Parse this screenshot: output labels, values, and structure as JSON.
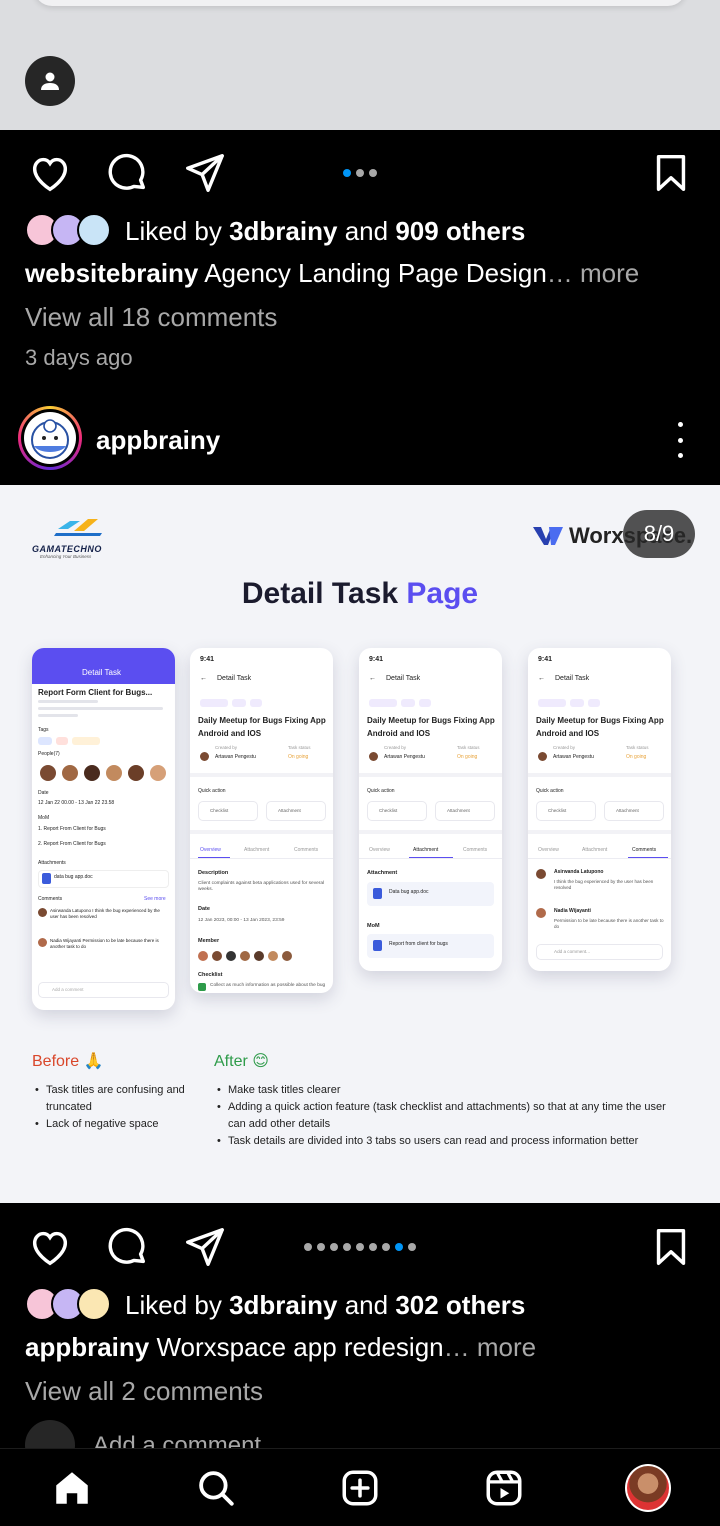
{
  "previous_post": {
    "likes": {
      "prefix": "Liked by",
      "user": "3dbrainy",
      "conj": "and",
      "others": "909 others"
    },
    "caption": {
      "user": "websitebrainy",
      "text": "Agency Landing Page Design",
      "more": "… more"
    },
    "view_comments": "View all 18 comments",
    "time_ago": "3 days ago"
  },
  "post": {
    "username": "appbrainy",
    "image_counter": "8/9",
    "image": {
      "logo_left": {
        "name": "GAMATECHNO",
        "tagline": "Enhancing Your Business"
      },
      "logo_right": "Worxspace.",
      "title_a": "Detail Task",
      "title_b": "Page",
      "before_label": "Before 🙏",
      "after_label": "After 😊",
      "before_points": [
        "Task titles are confusing and truncated",
        "Lack of negative space"
      ],
      "after_points": [
        "Make task titles clearer",
        "Adding a quick action feature (task checklist and attachments) so that at any time the user can add other details",
        "Task details are divided into 3 tabs so users can read and process information better"
      ],
      "phones": {
        "before": {
          "header": "Detail Task",
          "task_title": "Report Form Client for Bugs...",
          "tags_label": "Tags",
          "people_label": "People(7)",
          "date_label": "Date",
          "date_value": "12 Jan 22 00.00 - 13 Jan 22 23.58",
          "mom_label": "MoM",
          "mom_1": "1. Report From Client for Bugs",
          "mom_2": "2. Report From Client for Bugs",
          "attachments_label": "Attachments",
          "attachment_file": "data bug app.doc",
          "comments_label": "Comments",
          "see_more": "See more",
          "comment_1": "Asirwanda Latupono I think the bug experienced by the user has been resolved",
          "comment_2": "Nadia Wijayanti Permission to be late because there is another task to do",
          "add_comment": "Add a comment"
        },
        "after_common": {
          "time": "9:41",
          "header": "Detail Task",
          "tags": [
            "Necessary",
            "Bugs",
            "API"
          ],
          "task_title_1": "Daily Meetup for Bugs Fixing App",
          "task_title_2": "Android and IOS",
          "created_by_label": "Created by",
          "created_by": "Artawan Pengestu",
          "status_label": "Task status",
          "status": "On going",
          "quick_action": "Quick action",
          "checklist": "Checklist",
          "attachment": "Attachment",
          "tabs": [
            "Overview",
            "Attachment",
            "Comments"
          ]
        },
        "after_1": {
          "description_label": "Description",
          "description": "Client complaints against beta applications used for several weeks.",
          "date_label": "Date",
          "date_value": "12 Jan 2023, 00:00 - 13 Jan 2023, 23:59",
          "member_label": "Member",
          "checklist_label": "Checklist",
          "checklist_item": "Collect as much information as possible about the bug"
        },
        "after_2": {
          "attachment_label": "Attachment",
          "file": "Data bug app.doc",
          "mom_label": "MoM",
          "mom_1": "Report from client for bugs",
          "mom_2": "Report from client for bugs"
        },
        "after_3": {
          "comment_1_name": "Asirwanda Latupono",
          "comment_1": "I think the bug experienced by the user has been resolved",
          "comment_2_name": "Nadia Wijayanti",
          "comment_2": "Permission to be late because there is another task to do",
          "add_comment": "Add a comment..."
        }
      }
    },
    "likes": {
      "prefix": "Liked by",
      "user": "3dbrainy",
      "conj": "and",
      "others": "302 others"
    },
    "caption": {
      "user": "appbrainy",
      "text": "Worxspace app redesign",
      "more": "… more"
    },
    "view_comments": "View all 2 comments",
    "add_comment": "Add a comment..."
  },
  "carousel_previous": {
    "count": 3,
    "active": 0
  },
  "carousel_current": {
    "count": 9,
    "active": 7
  },
  "colors": {
    "accent": "#0095f6",
    "brand_purple": "#5b4ef0",
    "background": "#000000"
  }
}
